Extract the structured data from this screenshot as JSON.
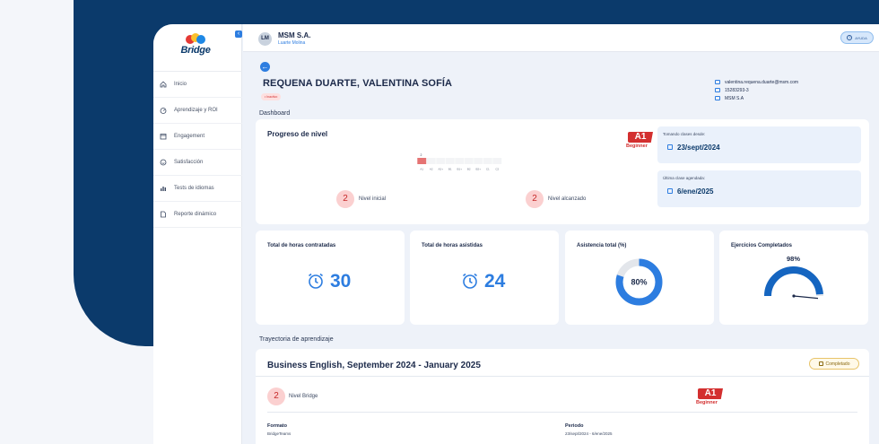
{
  "colors": {
    "navy": "#0b3a6b",
    "accent": "#2d7de0",
    "danger": "#d32f2f"
  },
  "logo": {
    "text": "Bridge"
  },
  "sidebar": {
    "items": [
      {
        "label": "Inicio",
        "icon": "home-icon"
      },
      {
        "label": "Aprendizaje y ROI",
        "icon": "gauge-icon"
      },
      {
        "label": "Engagement",
        "icon": "calendar-icon"
      },
      {
        "label": "Satisfacción",
        "icon": "smile-icon"
      },
      {
        "label": "Tests de idiomas",
        "icon": "bar-chart-icon"
      },
      {
        "label": "Reporte dinámico",
        "icon": "document-icon"
      }
    ]
  },
  "topbar": {
    "avatar_initials": "LM",
    "company": "MSM S.A.",
    "branch": "Luarte Molina",
    "help_label": "AYUDA"
  },
  "student": {
    "name": "REQUENA DUARTE, VALENTINA SOFÍA",
    "level_chip": "• Inactivo",
    "email": "valentina.requena.duarte@msm.com",
    "id": "15283293-3",
    "company": "MSM S.A"
  },
  "dashboard": {
    "label": "Dashboard",
    "progress": {
      "title": "Progreso de nivel",
      "badge": "A1",
      "badge_sub": "Beginner",
      "scale_labels": [
        "A1",
        "A2",
        "A2+",
        "B1",
        "B1+",
        "B2",
        "B2+",
        "C1",
        "C2"
      ],
      "scale_marker": "2",
      "initial_value": "2",
      "initial_label": "Nivel inicial",
      "reached_value": "2",
      "reached_label": "Nivel alcanzado"
    },
    "dates": {
      "since_label": "Tomando clases desde:",
      "since_value": "23/sept/2024",
      "last_label": "Última clase agendada:",
      "last_value": "6/ene/2025"
    },
    "stats": {
      "hours_contracted": {
        "title": "Total de horas contratadas",
        "value": "30"
      },
      "hours_attended": {
        "title": "Total de horas asistidas",
        "value": "24"
      },
      "attendance": {
        "title": "Asistencia total (%)",
        "value": "80%",
        "percent": 80
      },
      "exercises": {
        "title": "Ejercicios Completados",
        "value": "98%",
        "percent": 98
      }
    }
  },
  "trajectory": {
    "label": "Trayectoria de aprendizaje",
    "course_title": "Business English, September 2024 - January 2025",
    "status": "Completado",
    "level_value": "2",
    "level_label": "Nivel Bridge",
    "badge": "A1",
    "badge_sub": "Beginner",
    "format_label": "Formato",
    "format_value": "BridgeTeams",
    "period_label": "Periodo",
    "period_value": "23/sept/2024 - 6/ene/2025"
  }
}
